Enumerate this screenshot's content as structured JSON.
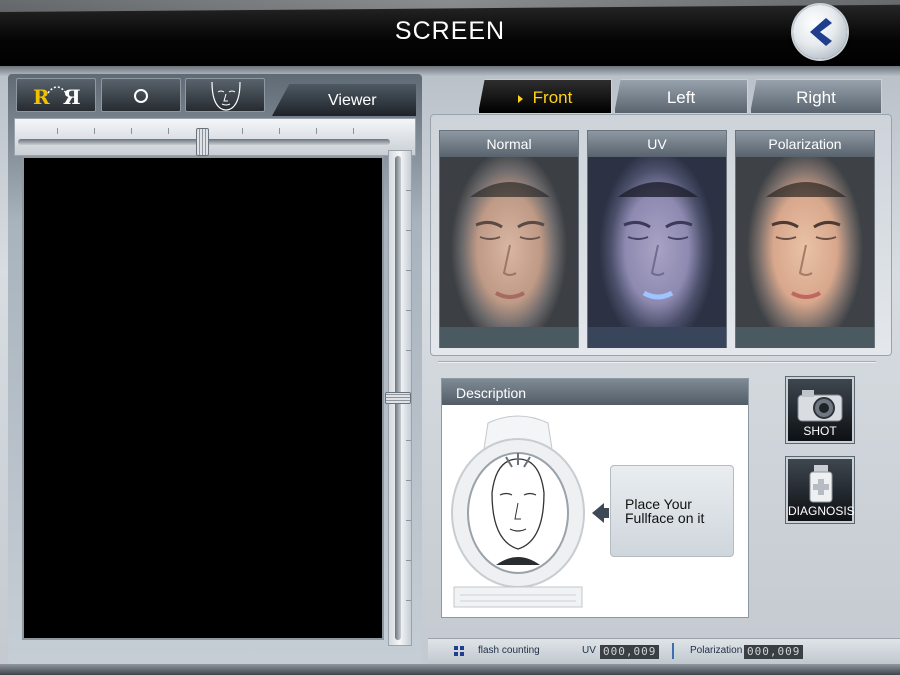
{
  "header": {
    "title": "SCREEN",
    "back_icon": "chevron-left-icon"
  },
  "toolbar": {
    "mirror_icon": "mirror-r-icon",
    "mirror_label_left": "R",
    "mirror_label_right": "Я",
    "record_icon": "circle-icon",
    "face_icon": "face-outline-icon",
    "viewer_tab": "Viewer"
  },
  "views": {
    "tabs": [
      {
        "label": "Front",
        "active": true
      },
      {
        "label": "Left",
        "active": false
      },
      {
        "label": "Right",
        "active": false
      }
    ]
  },
  "photos": [
    {
      "label": "Normal"
    },
    {
      "label": "UV"
    },
    {
      "label": "Polarization"
    }
  ],
  "description": {
    "title": "Description",
    "instruction": "Place Your Fullface on it"
  },
  "actions": {
    "shot": "SHOT",
    "diagnosis": "DIAGNOSIS"
  },
  "status": {
    "flash_label": "flash counting",
    "uv_label": "UV",
    "uv_count": "000,009",
    "pol_label": "Polarization",
    "pol_count": "000,009"
  },
  "colors": {
    "active_tab_text": "#ffd21a",
    "title_bar": "#000000"
  }
}
